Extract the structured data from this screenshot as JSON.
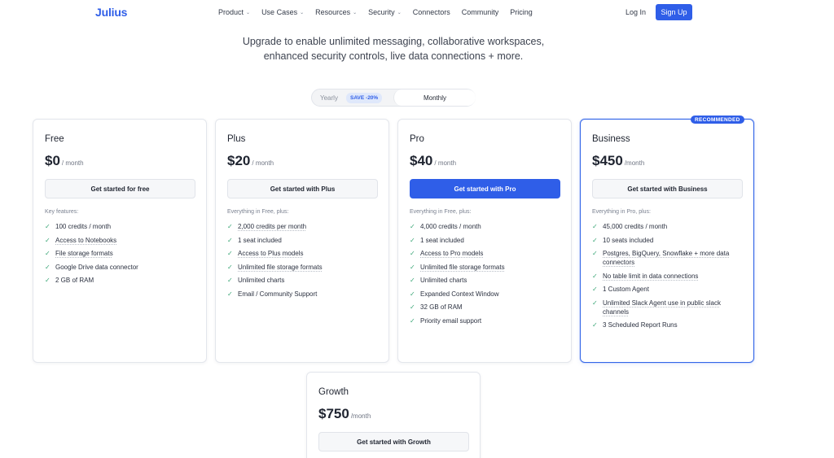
{
  "nav": {
    "logo": "Julius",
    "menu": [
      {
        "label": "Product",
        "dropdown": true
      },
      {
        "label": "Use Cases",
        "dropdown": true
      },
      {
        "label": "Resources",
        "dropdown": true
      },
      {
        "label": "Security",
        "dropdown": true
      },
      {
        "label": "Connectors",
        "dropdown": false
      },
      {
        "label": "Community",
        "dropdown": false
      },
      {
        "label": "Pricing",
        "dropdown": false
      }
    ],
    "login": "Log In",
    "signup": "Sign Up"
  },
  "subtitle": {
    "line1": "Upgrade to enable unlimited messaging, collaborative workspaces,",
    "line2": "enhanced security controls, live data connections + more."
  },
  "billing_toggle": {
    "yearly": "Yearly",
    "save_badge": "SAVE -20%",
    "monthly": "Monthly",
    "selected": "Monthly"
  },
  "recommended_badge": "RECOMMENDED",
  "plans": [
    {
      "name": "Free",
      "price": "$0",
      "period": "/ month",
      "cta": "Get started for free",
      "features_head": "Key features:",
      "features": [
        {
          "text": "100 credits / month",
          "u": false
        },
        {
          "text": "Access to Notebooks",
          "u": true
        },
        {
          "text": "File storage formats",
          "u": true
        },
        {
          "text": "Google Drive data connector",
          "u": false
        },
        {
          "text": "2 GB of RAM",
          "u": false
        }
      ]
    },
    {
      "name": "Plus",
      "price": "$20",
      "period": "/ month",
      "cta": "Get started with Plus",
      "features_head": "Everything in Free, plus:",
      "features": [
        {
          "text": "2,000 credits per month",
          "u": true
        },
        {
          "text": "1 seat included",
          "u": false
        },
        {
          "text": "Access to Plus models",
          "u": true
        },
        {
          "text": "Unlimited file storage formats",
          "u": true
        },
        {
          "text": "Unlimited charts",
          "u": false
        },
        {
          "text": "Email / Community Support",
          "u": false
        }
      ]
    },
    {
      "name": "Pro",
      "price": "$40",
      "period": "/ month",
      "cta": "Get started with Pro",
      "features_head": "Everything in Free, plus:",
      "features": [
        {
          "text": "4,000 credits / month",
          "u": false
        },
        {
          "text": "1 seat included",
          "u": false
        },
        {
          "text": "Access to Pro models",
          "u": true
        },
        {
          "text": "Unlimited file storage formats",
          "u": true
        },
        {
          "text": "Unlimited charts",
          "u": false
        },
        {
          "text": "Expanded Context Window",
          "u": false
        },
        {
          "text": "32 GB of RAM",
          "u": false
        },
        {
          "text": "Priority email support",
          "u": false
        }
      ]
    },
    {
      "name": "Business",
      "price": "$450",
      "period": "/month",
      "cta": "Get started with Business",
      "features_head": "Everything in Pro, plus:",
      "features": [
        {
          "text": "45,000 credits / month",
          "u": false
        },
        {
          "text": "10 seats included",
          "u": false
        },
        {
          "text": "Postgres, BigQuery, Snowflake + more data connectors",
          "u": true
        },
        {
          "text": "No table limit in data connections",
          "u": true
        },
        {
          "text": "1 Custom Agent",
          "u": false
        },
        {
          "text": "Unlimited Slack Agent use in public slack channels",
          "u": true
        },
        {
          "text": "3 Scheduled Report Runs",
          "u": false
        }
      ]
    },
    {
      "name": "Growth",
      "price": "$750",
      "period": "/month",
      "cta": "Get started with Growth",
      "features_head": "",
      "features": []
    }
  ],
  "colors": {
    "accent": "#2f5ee8",
    "check": "#3aa676",
    "business_border": "#3366e8"
  }
}
